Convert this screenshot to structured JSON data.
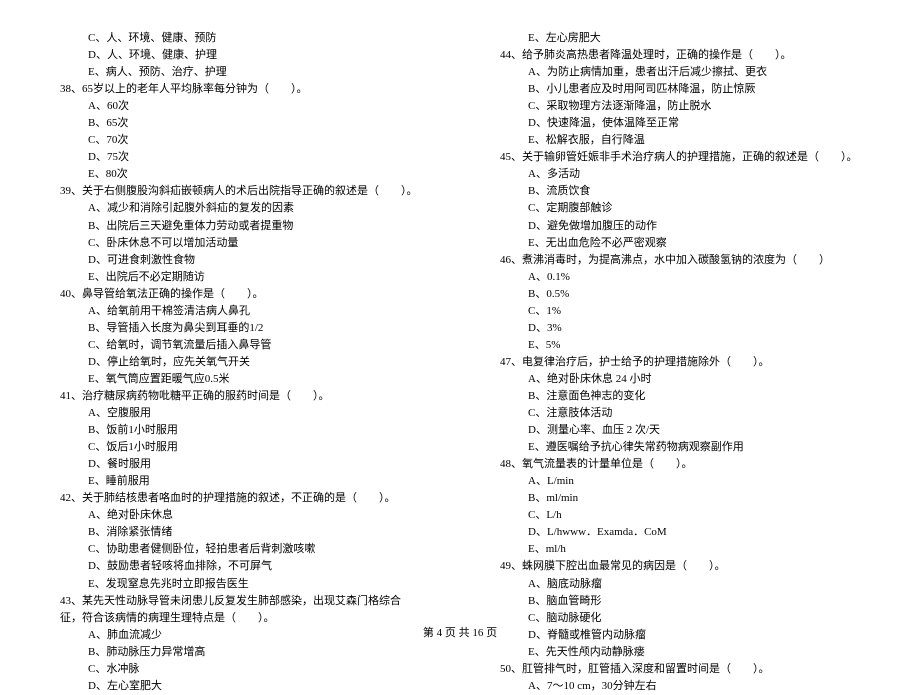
{
  "left": {
    "opts_pre": [
      "C、人、环境、健康、预防",
      "D、人、环境、健康、护理",
      "E、病人、预防、治疗、护理"
    ],
    "q38": "38、65岁以上的老年人平均脉率每分钟为（　　）。",
    "q38_opts": [
      "A、60次",
      "B、65次",
      "C、70次",
      "D、75次",
      "E、80次"
    ],
    "q39": "39、关于右侧腹股沟斜疝嵌顿病人的术后出院指导正确的叙述是（　　）。",
    "q39_opts": [
      "A、减少和消除引起腹外斜疝的复发的因素",
      "B、出院后三天避免重体力劳动或者提重物",
      "C、卧床休息不可以增加活动量",
      "D、可进食刺激性食物",
      "E、出院后不必定期随访"
    ],
    "q40": "40、鼻导管给氧法正确的操作是（　　）。",
    "q40_opts": [
      "A、给氧前用干棉签清洁病人鼻孔",
      "B、导管插入长度为鼻尖到耳垂的1/2",
      "C、给氧时，调节氧流量后插入鼻导管",
      "D、停止给氧时，应先关氧气开关",
      "E、氧气筒应置距暖气应0.5米"
    ],
    "q41": "41、治疗糖尿病药物吡糖平正确的服药时间是（　　）。",
    "q41_opts": [
      "A、空腹服用",
      "B、饭前1小时服用",
      "C、饭后1小时服用",
      "D、餐时服用",
      "E、睡前服用"
    ],
    "q42": "42、关于肺结核患者咯血时的护理措施的叙述，不正确的是（　　）。",
    "q42_opts": [
      "A、绝对卧床休息",
      "B、消除紧张情绪",
      "C、协助患者健侧卧位，轻拍患者后背刺激咳嗽",
      "D、鼓励患者轻咳将血排除，不可屏气",
      "E、发现窒息先兆时立即报告医生"
    ],
    "q43": "43、某先天性动脉导管未闭患儿反复发生肺部感染，出现艾森门格综合征，符合该病情的病理生理特点是（　　）。",
    "q43_opts": [
      "A、肺血流减少",
      "B、肺动脉压力异常增高",
      "C、水冲脉",
      "D、左心室肥大"
    ]
  },
  "right": {
    "opts_pre": [
      "E、左心房肥大"
    ],
    "q44": "44、给予肺炎高热患者降温处理时，正确的操作是（　　）。",
    "q44_opts": [
      "A、为防止病情加重，患者出汗后减少擦拭、更衣",
      "B、小儿患者应及时用阿司匹林降温，防止惊厥",
      "C、采取物理方法逐渐降温，防止脱水",
      "D、快速降温，使体温降至正常",
      "E、松解衣服，自行降温"
    ],
    "q45": "45、关于输卵管妊娠非手术治疗病人的护理措施，正确的叙述是（　　）。",
    "q45_opts": [
      "A、多活动",
      "B、流质饮食",
      "C、定期腹部触诊",
      "D、避免做增加腹压的动作",
      "E、无出血危险不必严密观察"
    ],
    "q46": "46、煮沸消毒时，为提高沸点，水中加入碳酸氢钠的浓度为（　　）",
    "q46_opts": [
      "A、0.1%",
      "B、0.5%",
      "C、1%",
      "D、3%",
      "E、5%"
    ],
    "q47": "47、电复律治疗后，护士给予的护理措施除外（　　）。",
    "q47_opts": [
      "A、绝对卧床休息 24 小时",
      "B、注意面色神志的变化",
      "C、注意肢体活动",
      "D、测量心率、血压 2 次/天",
      "E、遵医嘱给予抗心律失常药物病观察副作用"
    ],
    "q48": "48、氧气流量表的计量单位是（　　）。",
    "q48_opts": [
      "A、L/min",
      "B、ml/min",
      "C、L/h",
      "D、L/hwww．Examda．CoM",
      "E、ml/h"
    ],
    "q49": "49、蛛网膜下腔出血最常见的病因是（　　）。",
    "q49_opts": [
      "A、脑底动脉瘤",
      "B、脑血管畸形",
      "C、脑动脉硬化",
      "D、脊髓或椎管内动脉瘤",
      "E、先天性颅内动静脉瘘"
    ],
    "q50": "50、肛管排气时，肛管插入深度和留置时间是（　　）。",
    "q50_opts": [
      "A、7～10 cm，30分钟左右"
    ]
  },
  "footer": "第 4 页 共 16 页"
}
